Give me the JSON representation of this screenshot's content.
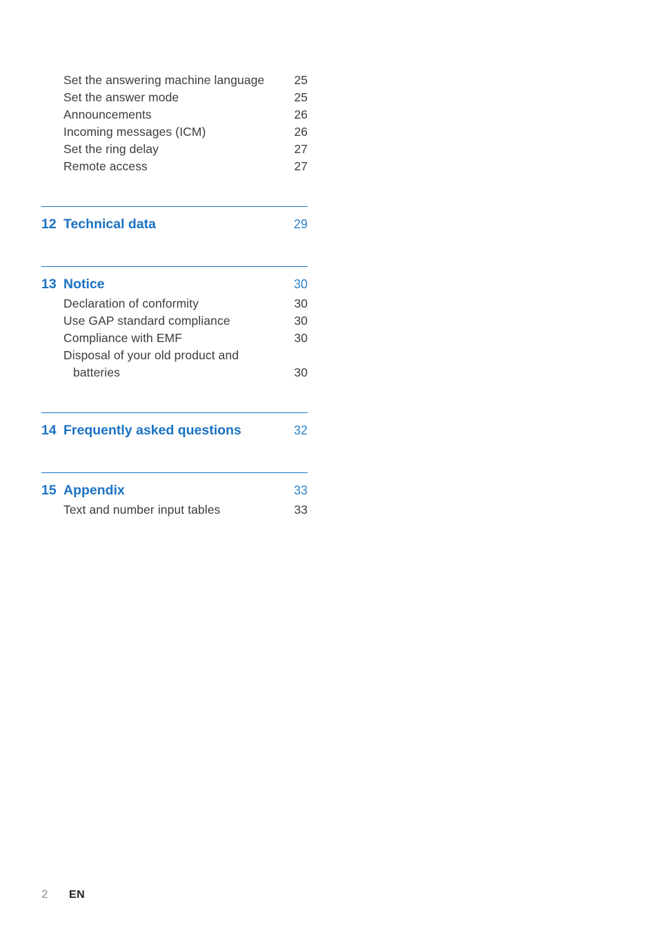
{
  "document": {
    "type": "table-of-contents",
    "accent_color": "#1a72c4",
    "text_color": "#3c3c3c"
  },
  "toc": {
    "continued_entries": [
      {
        "label": "Set the answering machine language",
        "page": "25"
      },
      {
        "label": "Set the answer mode",
        "page": "25"
      },
      {
        "label": "Announcements",
        "page": "26"
      },
      {
        "label": "Incoming messages (ICM)",
        "page": "26"
      },
      {
        "label": "Set the ring delay",
        "page": "27"
      },
      {
        "label": "Remote access",
        "page": "27"
      }
    ],
    "sections": [
      {
        "number": "12",
        "title": "Technical data",
        "page": "29",
        "entries": []
      },
      {
        "number": "13",
        "title": "Notice",
        "page": "30",
        "entries": [
          {
            "label": "Declaration of conformity",
            "page": "30"
          },
          {
            "label": "Use GAP standard compliance",
            "page": "30"
          },
          {
            "label": "Compliance with EMF",
            "page": "30"
          },
          {
            "label": "Disposal of your old product and",
            "page": ""
          },
          {
            "label": "batteries",
            "page": "30",
            "continuation": true
          }
        ]
      },
      {
        "number": "14",
        "title": "Frequently asked questions",
        "page": "32",
        "entries": []
      },
      {
        "number": "15",
        "title": "Appendix",
        "page": "33",
        "entries": [
          {
            "label": "Text and number input tables",
            "page": "33"
          }
        ]
      }
    ]
  },
  "footer": {
    "page_number": "2",
    "language": "EN"
  }
}
